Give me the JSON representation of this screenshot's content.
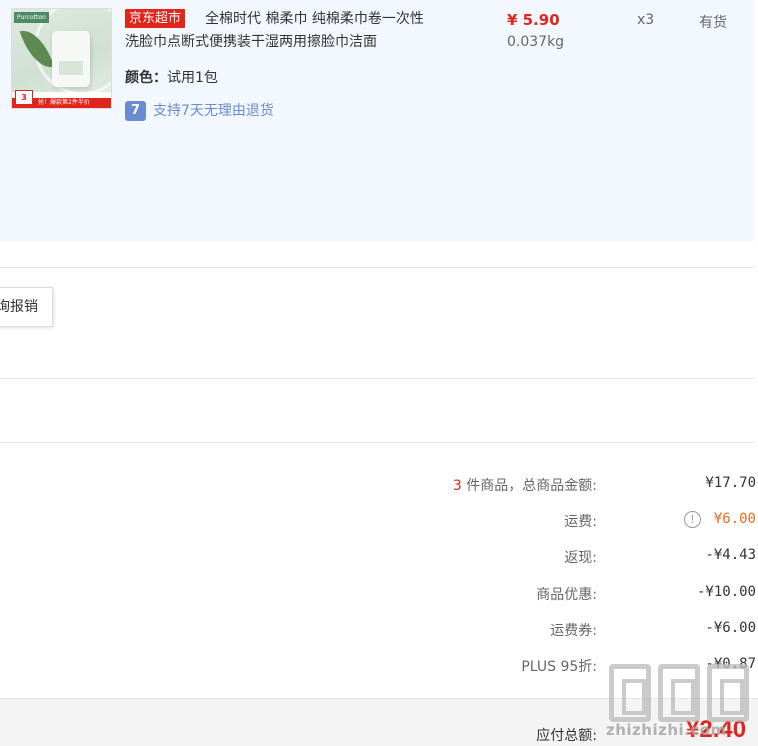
{
  "product": {
    "thumbnail": {
      "brand_text": "Purcotton",
      "badge_text": "3",
      "banner_text": "抢！爆款第2件半价"
    },
    "store_badge": "京东超市",
    "title": "全棉时代 棉柔巾 纯棉柔巾卷一次性洗脸巾点断式便携装干湿两用擦脸巾洁面",
    "attribute_label": "颜色：",
    "attribute_value": "试用1包",
    "return_icon_glyph": "7",
    "return_policy": "支持7天无理由退货",
    "price": "¥ 5.90",
    "weight": "0.037kg",
    "quantity": "x3",
    "stock_status": "有货"
  },
  "reimburse_button_label": "询报销",
  "summary": {
    "items_count": "3",
    "items_label": " 件商品，总商品金额:",
    "items_total": "¥17.70",
    "shipping_label": "运费:",
    "shipping_value": "¥6.00",
    "cashback_label": "返现:",
    "cashback_value": "-¥4.43",
    "discount_label": "商品优惠:",
    "discount_value": "-¥10.00",
    "coupon_label": "运费券:",
    "coupon_value": "-¥6.00",
    "plus_label": "PLUS 95折:",
    "plus_value": "-¥0.87",
    "total_label": "应付总额:",
    "total_value": "¥2.40"
  },
  "watermark": {
    "text": "zhizhizhi.com"
  },
  "colors": {
    "accent_red": "#e1251b",
    "shipping_orange": "#e3701f",
    "return_blue": "#6a8bd3",
    "panel_bg": "#f3f8fe"
  },
  "icons": {
    "info": "info-circle-icon",
    "return": "seven-day-return-icon"
  }
}
